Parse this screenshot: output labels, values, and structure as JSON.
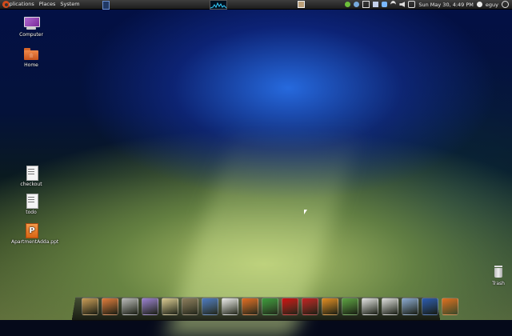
{
  "top_panel": {
    "menus": [
      "Applications",
      "Places",
      "System"
    ],
    "clock": "Sun May 30,  4:49 PM",
    "user": "eguy"
  },
  "desktop_icons": [
    {
      "label": "Computer",
      "icon": "computer-icon"
    },
    {
      "label": "Home",
      "icon": "home-folder-icon"
    },
    {
      "label": "checkout",
      "icon": "text-file-icon"
    },
    {
      "label": "todo",
      "icon": "text-file-icon"
    },
    {
      "label": "ApartmentAdda.ppt",
      "icon": "presentation-file-icon"
    },
    {
      "label": "Trash",
      "icon": "trash-icon"
    }
  ],
  "dock": {
    "items": [
      {
        "name": "archive-icon",
        "color": "#c89a55"
      },
      {
        "name": "folder-icon",
        "color": "#e07a3a"
      },
      {
        "name": "screenshot-icon",
        "color": "#b8b8b8"
      },
      {
        "name": "pidgin-icon",
        "color": "#9a7fd0"
      },
      {
        "name": "mail-icon",
        "color": "#d8c890"
      },
      {
        "name": "gimp-icon",
        "color": "#8a7a5a"
      },
      {
        "name": "people-icon",
        "color": "#4a78c0"
      },
      {
        "name": "text-editor-icon",
        "color": "#e8e8e8"
      },
      {
        "name": "firefox-icon",
        "color": "#e06a20"
      },
      {
        "name": "chrome-icon",
        "color": "#3a9a3a"
      },
      {
        "name": "opera-icon",
        "color": "#cc1010"
      },
      {
        "name": "filezilla-icon",
        "color": "#c02020"
      },
      {
        "name": "butterfly-icon",
        "color": "#e08a20"
      },
      {
        "name": "scissors-icon",
        "color": "#5aa040"
      },
      {
        "name": "notes-icon",
        "color": "#e0e0e0"
      },
      {
        "name": "calendar-icon",
        "color": "#dcdcdc"
      },
      {
        "name": "settings-tool-icon",
        "color": "#8aa8d0"
      },
      {
        "name": "terminal-icon",
        "color": "#2a5ab0"
      },
      {
        "name": "powerpoint-icon",
        "color": "#e07020"
      }
    ]
  }
}
